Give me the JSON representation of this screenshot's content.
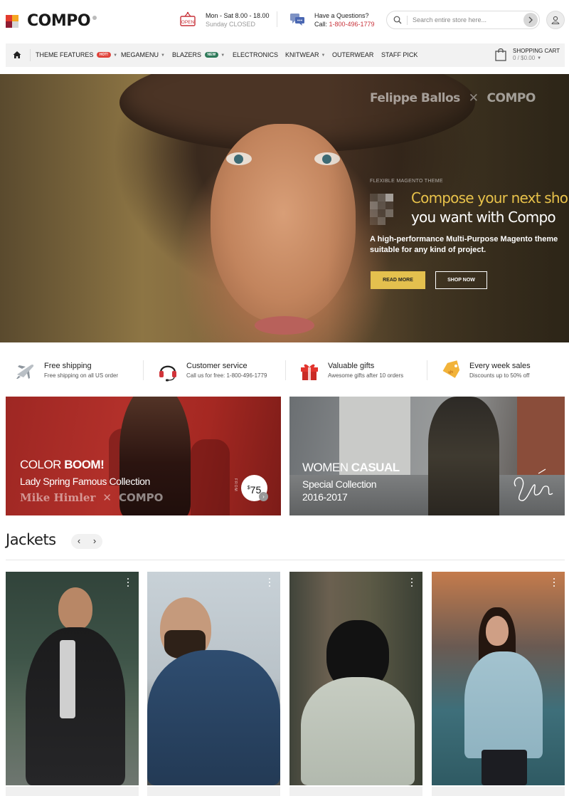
{
  "brand": {
    "name": "COMPO"
  },
  "header": {
    "hours_icon_label": "OPEN",
    "hours_line1": "Mon - Sat 8.00 - 18.00",
    "hours_line2": "Sunday CLOSED",
    "question_line1": "Have a Questions?",
    "question_label": "Call: ",
    "question_phone": "1-800-496-1779",
    "search_placeholder": "Search entire store here...",
    "account_icon": "user-icon"
  },
  "nav": {
    "items": [
      {
        "label": "Theme Features",
        "badge": "HOT!",
        "badge_color": "#e0443c",
        "dropdown": true
      },
      {
        "label": "Megamenu",
        "dropdown": true
      },
      {
        "label": "Blazers",
        "badge": "NEW",
        "badge_color": "#2f7a5a",
        "dropdown": true
      },
      {
        "label": "Electronics",
        "dropdown": false
      },
      {
        "label": "Knitwear",
        "dropdown": true
      },
      {
        "label": "Outerwear",
        "dropdown": false
      },
      {
        "label": "Staff Pick",
        "dropdown": false
      }
    ],
    "cart_title": "Shopping Cart",
    "cart_summary": "0 / $0.00"
  },
  "hero": {
    "photographer": "Felippe Ballos",
    "brand": "COMPO",
    "eyebrow": "Flexible Magento Theme",
    "heading_line1": "Compose your next shop",
    "heading_line2": "you want with Compo",
    "subtitle": "A high-performance Multi-Purpose Magento theme suitable for any kind of project.",
    "read_more": "Read More",
    "shop_now": "Shop Now",
    "accent_color": "#e4c04e"
  },
  "features": [
    {
      "title": "Free shipping",
      "desc": "Free shipping on all US order",
      "icon": "airplane-icon"
    },
    {
      "title": "Customer service",
      "desc": "Call us for free: 1-800-496-1779",
      "icon": "headset-icon"
    },
    {
      "title": "Valuable gifts",
      "desc": "Awesome gifts after 10 orders",
      "icon": "gift-icon"
    },
    {
      "title": "Every week sales",
      "desc": "Discounts up to 50% off",
      "icon": "tag-icon"
    }
  ],
  "banners": {
    "left": {
      "title_light": "COLOR ",
      "title_bold": "BOOM!",
      "subtitle": "Lady Spring Famous Collection",
      "photographer": "Mike Himler",
      "brand": "COMPO",
      "from_label": "From",
      "currency": "$",
      "price": "75"
    },
    "right": {
      "title_light": "WOMEN ",
      "title_bold": "CASUAL",
      "subtitle_line1": "Special Collection",
      "subtitle_line2": "2016-2017"
    }
  },
  "jackets": {
    "title": "Jackets",
    "prev": "‹",
    "next": "›"
  }
}
